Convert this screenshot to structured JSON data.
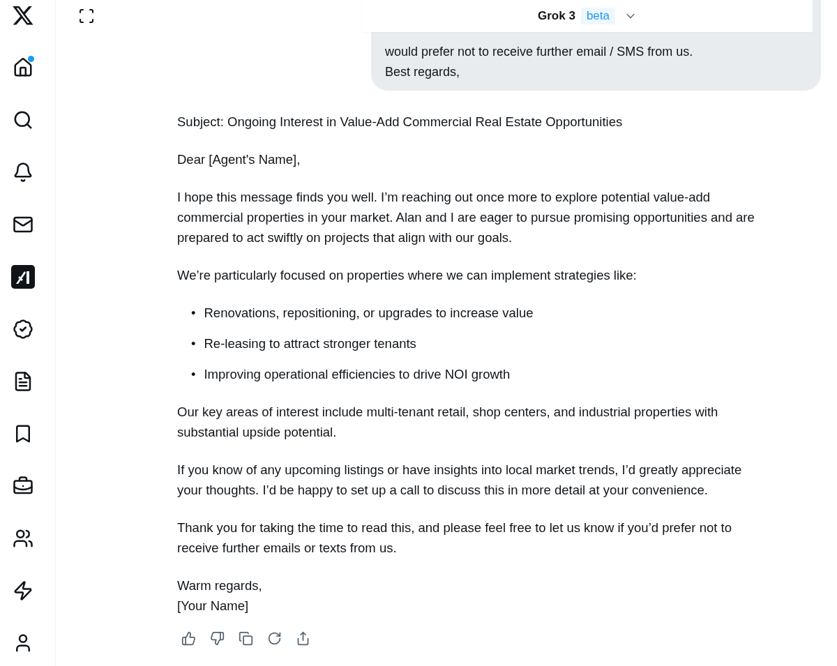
{
  "sidebar": {
    "items": [
      {
        "kind": "logo",
        "unread": false
      },
      {
        "kind": "home",
        "unread": true
      },
      {
        "kind": "search",
        "unread": false
      },
      {
        "kind": "notifications",
        "unread": false
      },
      {
        "kind": "messages",
        "unread": false
      },
      {
        "kind": "grok",
        "unread": false
      },
      {
        "kind": "verified",
        "unread": false
      },
      {
        "kind": "lists",
        "unread": false
      },
      {
        "kind": "bookmarks",
        "unread": false
      },
      {
        "kind": "jobs",
        "unread": false
      },
      {
        "kind": "communities",
        "unread": false
      },
      {
        "kind": "premium",
        "unread": false
      },
      {
        "kind": "profile",
        "unread": false
      }
    ]
  },
  "header": {
    "model": "Grok 3",
    "badge": "beta"
  },
  "user_message": {
    "lines": [
      "would prefer not to receive further email / SMS from us.",
      "Best regards,"
    ]
  },
  "reply": {
    "blocks": [
      {
        "kind": "paragraph",
        "text": "Subject: Ongoing Interest in Value-Add Commercial Real Estate Opportunities"
      },
      {
        "kind": "paragraph",
        "text": "Dear [Agent's Name],"
      },
      {
        "kind": "paragraph",
        "text": "I hope this message finds you well. I’m reaching out once more to explore potential value-add commercial properties in your market. Alan and I are eager to pursue promising opportunities and are prepared to act swiftly on projects that align with our goals."
      },
      {
        "kind": "paragraph",
        "text": "We’re particularly focused on properties where we can implement strategies like:"
      },
      {
        "kind": "bullets",
        "marker": "•",
        "items": [
          "Renovations, repositioning, or upgrades to increase value",
          "Re-leasing to attract stronger tenants",
          "Improving operational efficiencies to drive NOI growth"
        ]
      },
      {
        "kind": "paragraph",
        "text": "Our key areas of interest include multi-tenant retail, shop centers, and industrial properties with substantial upside potential."
      },
      {
        "kind": "paragraph",
        "text": "If you know of any upcoming listings or have insights into local market trends, I’d greatly appreciate your thoughts. I’d be happy to set up a call to discuss this in more detail at your convenience."
      },
      {
        "kind": "paragraph",
        "text": "Thank you for taking the time to read this, and please feel free to let us know if you’d prefer not to receive further emails or texts from us."
      },
      {
        "kind": "lines",
        "items": [
          "Warm regards,",
          "[Your Name]"
        ]
      }
    ]
  },
  "actions": [
    {
      "kind": "like"
    },
    {
      "kind": "dislike"
    },
    {
      "kind": "copy"
    },
    {
      "kind": "regenerate"
    },
    {
      "kind": "share"
    }
  ]
}
